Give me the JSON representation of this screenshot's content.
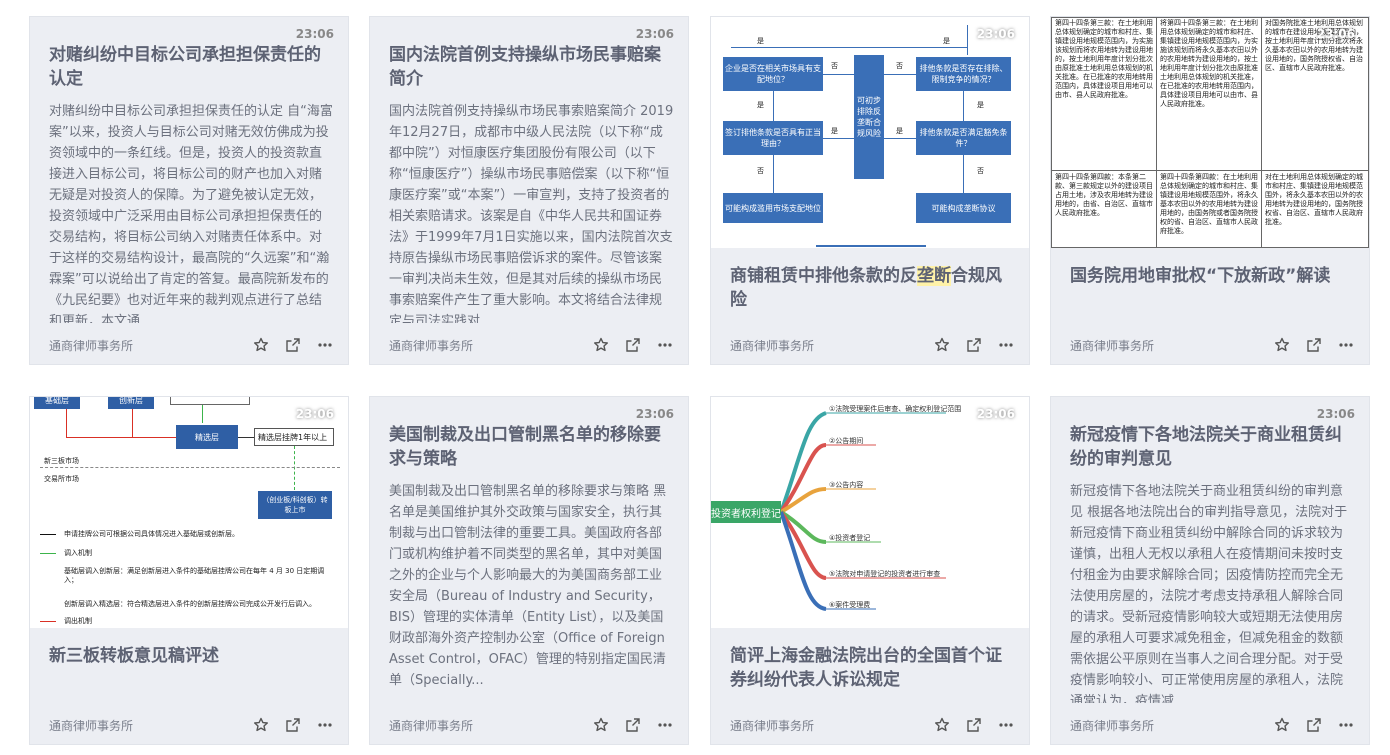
{
  "cards": [
    {
      "time": "23:06",
      "title": "对赌纠纷中目标公司承担担保责任的认定",
      "excerpt": "对赌纠纷中目标公司承担担保责任的认定 自“海富案”以来，投资人与目标公司对赌无效仿佛成为投资领域中的一条红线。但是，投资人的投资款直接进入目标公司，将目标公司的财产也加入对赌无疑是对投资人的保障。为了避免被认定无效，投资领域中广泛采用由目标公司承担担保责任的交易结构，将目标公司纳入对赌责任体系中。对于这样的交易结构设计，最高院的“久远案”和“瀚霖案”可以说给出了肯定的答复。最高院新发布的《九民纪要》也对近年来的裁判观点进行了总结和更新，本文通",
      "firm": "通商律师事务所"
    },
    {
      "time": "23:06",
      "title": "国内法院首例支持操纵市场民事赔案简介",
      "excerpt": "国内法院首例支持操纵市场民事索赔案简介 2019年12月27日，成都市中级人民法院（以下称“成都中院”）对恒康医疗集团股份有限公司（以下称“恒康医疗”）操纵市场民事赔偿案（以下称“恒康医疗案”或“本案”）一审宣判，支持了投资者的相关索赔请求。该案是自《中华人民共和国证券法》于1999年7月1日实施以来，国内法院首次支持原告操纵市场民事赔偿诉求的案件。尽管该案一审判决尚未生效，但是其对后续的操纵市场民事索赔案件产生了重大影响。本文将结合法律规定与司法实践对",
      "firm": "通商律师事务所"
    },
    {
      "time": "23:06",
      "title_a": "商铺租赁中排他条款的反",
      "title_hl": "垄断",
      "title_b": "合规风险",
      "firm": "通商律师事务所",
      "flow": {
        "yes": "是",
        "no": "否",
        "q1": "企业是否在相关市场具有支配地位？",
        "q2": "排他条款是否存在排除、限制竞争的情况？",
        "q3": "签订排他条款是否具有正当理由？",
        "q4": "排他条款是否满足豁免条件？",
        "center": "可初步排除反垄断合规风险",
        "r1": "可能构成滥用市场支配地位",
        "r2": "可能构成垄断协议"
      }
    },
    {
      "time": "23:06",
      "title": "国务院用地审批权“下放新政”解读",
      "firm": "通商律师事务所",
      "table": {
        "r1c1": "第四十四条第三款：在土地利用总体规划确定的城市和村庄、集镇建设用地规模范围内，为实施该规划而将农用地转为建设用地的，按土地利用年度计划分批次由原批准土地利用总体规划的机关批准。在已批准的农用地转用范围内，具体建设项目用地可以由市、县人民政府批准。",
        "r1c2": "将第四十四条第三款：在土地利用总体规划确定的城市和村庄、集镇建设用地规模范围内，为实施该规划而将永久基本农田以外的农用地转为建设用地的，按土地利用年度计划分批次由原批准土地利用总体规划的机关批准，在已批准的农用地转用范围内，具体建设项目用地可以由市、县人民政府批准。",
        "r1c3": "对国务院批准土地利用总体规划的城市在建设用地规模范围内，按土地利用年度计划分批次将永久基本农田以外的农用地转为建设用地的，国务院授权省、自治区、直辖市人民政府批准。",
        "r2c1": "第四十四条第四款：本条第二款、第三款规定以外的建设项目占用土地，涉及农用地转为建设用地的，由省、自治区、直辖市人民政府批准。",
        "r2c2": "第四十四条第四款：在土地利用总体规划确定的城市和村庄、集镇建设用地规模范围外，将永久基本农田以外的农用地转为建设用地的，由国务院或者国务院授权的省、自治区、直辖市人民政府批准。",
        "r2c3": "对在土地利用总体规划确定的城市和村庄、集镇建设用地规模范围外，将永久基本农田以外的农用地转为建设用地的，国务院授权省、自治区、直辖市人民政府批准。"
      }
    },
    {
      "time": "23:06",
      "title": "新三板转板意见稿评述",
      "firm": "通商律师事务所",
      "diagram": {
        "box_a": "基础层",
        "box_b": "创新层",
        "box_c": "精选层",
        "box_d": "精选层挂牌1年以上",
        "box_e": "（创业板/科创板）转板上市",
        "market1": "新三板市场",
        "market2": "交易所市场",
        "legend1": "申请挂牌公司可根据公司具体情况进入基础层或创新层。",
        "legend2": "调入机制",
        "legend3": "基础层调入创新层：满足创新层进入条件的基础层挂牌公司在每年 4 月 30 日定期调入；",
        "legend4": "创新层调入精选层：符合精选层进入条件的创新层挂牌公司完成公开发行后调入。",
        "legend5": "调出机制"
      }
    },
    {
      "time": "23:06",
      "title": "美国制裁及出口管制黑名单的移除要求与策略",
      "excerpt": "美国制裁及出口管制黑名单的移除要求与策略 黑名单是美国维护其外交政策与国家安全，执行其制裁与出口管制法律的重要工具。美国政府各部门或机构维护着不同类型的黑名单，其中对美国之外的企业与个人影响最大的为美国商务部工业安全局（Bureau of Industry and Security，BIS）管理的实体清单（Entity List），以及美国财政部海外资产控制办公室（Office of Foreign Asset Control，OFAC）管理的特别指定国民清单（Specially...",
      "firm": "通商律师事务所"
    },
    {
      "time": "23:06",
      "title": "简评上海金融法院出台的全国首个证券纠纷代表人诉讼规定",
      "firm": "通商律师事务所",
      "mindmap": {
        "root": "投资者权利登记",
        "b1": "①法院受理案件后审查、确定权利登记范围",
        "b2": "②公告期间",
        "b3": "③公告内容",
        "b4": "④投资者登记",
        "b5": "⑤法院对申请登记的投资者进行审查",
        "b6": "⑥案件受理费"
      }
    },
    {
      "time": "23:06",
      "title": "新冠疫情下各地法院关于商业租赁纠纷的审判意见",
      "excerpt": "新冠疫情下各地法院关于商业租赁纠纷的审判意见 根据各地法院出台的审判指导意见，法院对于新冠疫情下商业租赁纠纷中解除合同的诉求较为谨慎，出租人无权以承租人在疫情期间未按时支付租金为由要求解除合同；因疫情防控而完全无法使用房屋的，法院才考虑支持承租人解除合同的请求。受新冠疫情影响较大或短期无法使用房屋的承租人可要求减免租金，但减免租金的数额需依据公平原则在当事人之间合理分配。对于受疫情影响较小、可正常使用房屋的承租人，法院通常认为，疫情减",
      "firm": "通商律师事务所"
    }
  ]
}
